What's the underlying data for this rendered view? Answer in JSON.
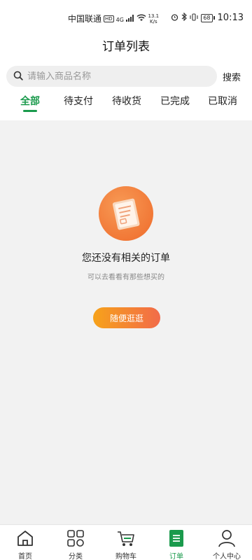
{
  "status_bar": {
    "carrier": "中国联通",
    "hd_badge": "HD",
    "signal_label": "4G",
    "net_speed_value": "13.1",
    "net_speed_unit": "K/s",
    "battery": "68",
    "time": "10:13"
  },
  "header": {
    "title": "订单列表"
  },
  "search": {
    "placeholder": "请输入商品名称",
    "value": "",
    "button_label": "搜索"
  },
  "tabs": [
    {
      "label": "全部",
      "active": true
    },
    {
      "label": "待支付",
      "active": false
    },
    {
      "label": "待收货",
      "active": false
    },
    {
      "label": "已完成",
      "active": false
    },
    {
      "label": "已取消",
      "active": false
    }
  ],
  "empty_state": {
    "title": "您还没有相关的订单",
    "subtitle": "可以去看看有那些想买的",
    "button_label": "随便逛逛"
  },
  "bottom_nav": [
    {
      "label": "首页",
      "icon": "home-icon",
      "active": false
    },
    {
      "label": "分类",
      "icon": "category-icon",
      "active": false
    },
    {
      "label": "购物车",
      "icon": "cart-icon",
      "active": false
    },
    {
      "label": "订单",
      "icon": "order-icon",
      "active": true
    },
    {
      "label": "个人中心",
      "icon": "profile-icon",
      "active": false
    }
  ],
  "colors": {
    "accent": "#1a9a4c",
    "button_gradient_start": "#f6a21a",
    "button_gradient_end": "#f26b4a"
  }
}
